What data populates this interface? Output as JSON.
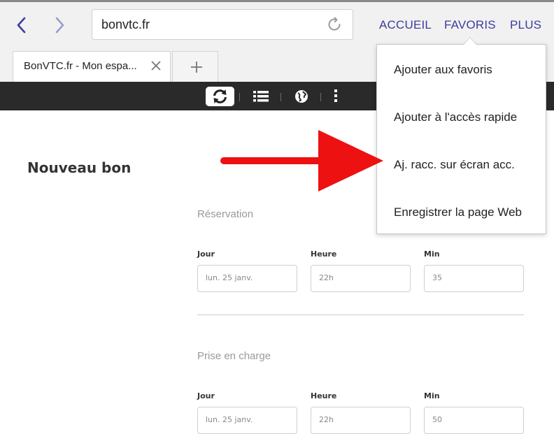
{
  "browser": {
    "url": "bonvtc.fr",
    "menu": {
      "home": "ACCUEIL",
      "favorites": "FAVORIS",
      "more": "PLUS"
    },
    "tab": {
      "title": "BonVTC.fr - Mon espa..."
    },
    "accent_color": "#3c3c9e"
  },
  "favorites_menu": {
    "items": [
      {
        "label": "Ajouter aux favoris"
      },
      {
        "label": "Ajouter à l'accès rapide"
      },
      {
        "label": "Aj. racc. sur écran acc."
      },
      {
        "label": "Enregistrer la page Web"
      }
    ]
  },
  "site_toolbar": {
    "icons": [
      "refresh-icon",
      "list-icon",
      "globe-icon",
      "more-vertical-icon"
    ]
  },
  "page": {
    "title": "Nouveau bon",
    "sections": [
      {
        "title": "Réservation",
        "fields": [
          {
            "label": "Jour",
            "value": "lun. 25 janv."
          },
          {
            "label": "Heure",
            "value": "22h"
          },
          {
            "label": "Min",
            "value": "35"
          }
        ]
      },
      {
        "title": "Prise en charge",
        "fields": [
          {
            "label": "Jour",
            "value": "lun. 25 janv."
          },
          {
            "label": "Heure",
            "value": "22h"
          },
          {
            "label": "Min",
            "value": "50"
          }
        ]
      }
    ]
  },
  "annotation": {
    "arrow_color": "#ee1111"
  }
}
